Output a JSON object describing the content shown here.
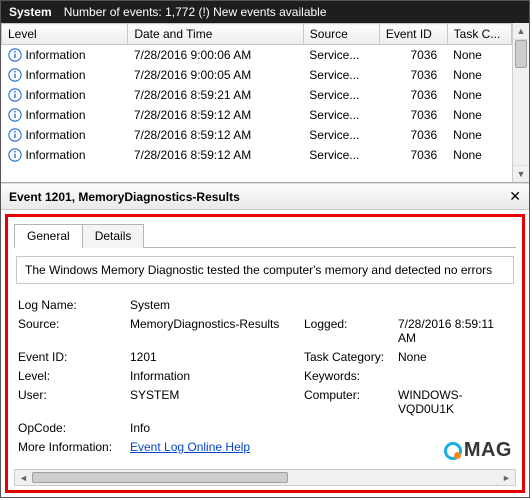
{
  "header": {
    "title": "System",
    "status": "Number of events: 1,772  (!) New events available"
  },
  "columns": {
    "level": "Level",
    "datetime": "Date and Time",
    "source": "Source",
    "eventid": "Event ID",
    "taskcat": "Task C..."
  },
  "rows": [
    {
      "level": "Information",
      "dt": "7/28/2016 9:00:06 AM",
      "src": "Service...",
      "eid": "7036",
      "task": "None"
    },
    {
      "level": "Information",
      "dt": "7/28/2016 9:00:05 AM",
      "src": "Service...",
      "eid": "7036",
      "task": "None"
    },
    {
      "level": "Information",
      "dt": "7/28/2016 8:59:21 AM",
      "src": "Service...",
      "eid": "7036",
      "task": "None"
    },
    {
      "level": "Information",
      "dt": "7/28/2016 8:59:12 AM",
      "src": "Service...",
      "eid": "7036",
      "task": "None"
    },
    {
      "level": "Information",
      "dt": "7/28/2016 8:59:12 AM",
      "src": "Service...",
      "eid": "7036",
      "task": "None"
    },
    {
      "level": "Information",
      "dt": "7/28/2016 8:59:12 AM",
      "src": "Service...",
      "eid": "7036",
      "task": "None"
    }
  ],
  "detail": {
    "header": "Event 1201, MemoryDiagnostics-Results",
    "tabs": {
      "general": "General",
      "details": "Details"
    },
    "message": "The Windows Memory Diagnostic tested the computer's memory and detected no errors",
    "labels": {
      "logname": "Log Name:",
      "source": "Source:",
      "eventid": "Event ID:",
      "level": "Level:",
      "user": "User:",
      "opcode": "OpCode:",
      "moreinfo": "More Information:",
      "logged": "Logged:",
      "taskcat": "Task Category:",
      "keywords": "Keywords:",
      "computer": "Computer:"
    },
    "values": {
      "logname": "System",
      "source": "MemoryDiagnostics-Results",
      "eventid": "1201",
      "level": "Information",
      "user": "SYSTEM",
      "opcode": "Info",
      "moreinfo_link": "Event Log Online Help",
      "logged": "7/28/2016 8:59:11 AM",
      "taskcat": "None",
      "keywords": "",
      "computer": "WINDOWS-VQD0U1K"
    }
  },
  "watermark": "MAG"
}
